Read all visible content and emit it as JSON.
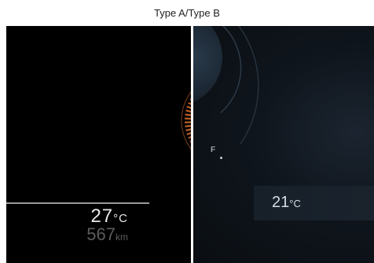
{
  "caption": "Type A/Type B",
  "type_a": {
    "outside_temp_value": "27",
    "outside_temp_unit": "°C",
    "range_value": "567",
    "range_unit": "km"
  },
  "type_b": {
    "fuel_label": "F",
    "outside_temp_value": "21",
    "outside_temp_unit": "°C"
  },
  "colors": {
    "gauge_accent": "#c8682a",
    "panel_bg": "#000000"
  }
}
